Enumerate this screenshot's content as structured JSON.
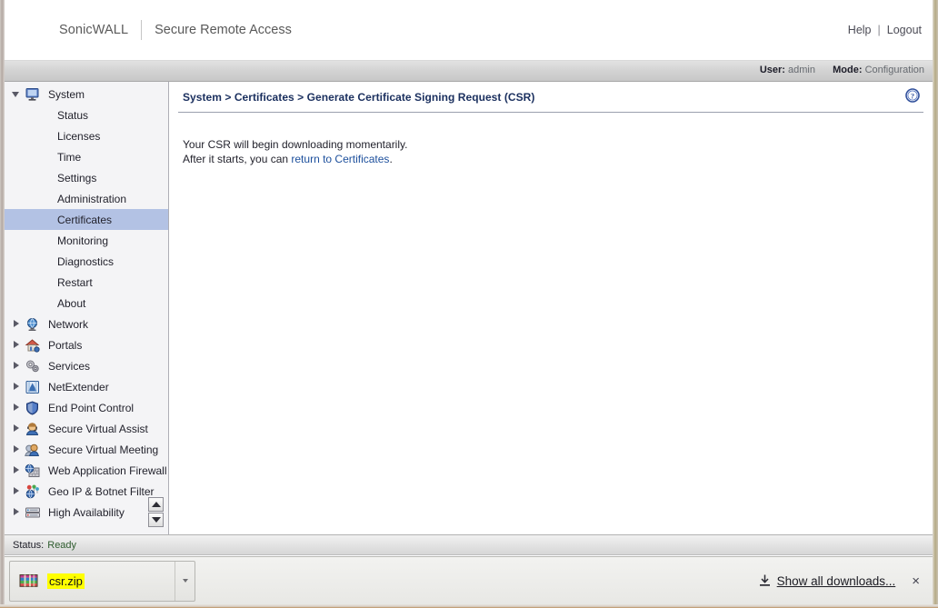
{
  "header": {
    "brand": "SonicWALL",
    "product": "Secure Remote Access",
    "help_link": "Help",
    "separator": "|",
    "logout_link": "Logout"
  },
  "status_strip": {
    "user_label": "User:",
    "user_value": "admin",
    "mode_label": "Mode:",
    "mode_value": "Configuration"
  },
  "sidebar": {
    "groups": [
      {
        "label": "System",
        "icon": "monitor-icon",
        "expanded": true,
        "twisty": "down",
        "children": [
          {
            "label": "Status",
            "selected": false
          },
          {
            "label": "Licenses",
            "selected": false
          },
          {
            "label": "Time",
            "selected": false
          },
          {
            "label": "Settings",
            "selected": false
          },
          {
            "label": "Administration",
            "selected": false
          },
          {
            "label": "Certificates",
            "selected": true
          },
          {
            "label": "Monitoring",
            "selected": false
          },
          {
            "label": "Diagnostics",
            "selected": false
          },
          {
            "label": "Restart",
            "selected": false
          },
          {
            "label": "About",
            "selected": false
          }
        ]
      },
      {
        "label": "Network",
        "icon": "globe-icon",
        "expanded": false,
        "twisty": "right",
        "children": []
      },
      {
        "label": "Portals",
        "icon": "house-icon",
        "expanded": false,
        "twisty": "right",
        "children": []
      },
      {
        "label": "Services",
        "icon": "gears-icon",
        "expanded": false,
        "twisty": "right",
        "children": []
      },
      {
        "label": "NetExtender",
        "icon": "netextender-icon",
        "expanded": false,
        "twisty": "right",
        "children": []
      },
      {
        "label": "End Point Control",
        "icon": "shield-icon",
        "expanded": false,
        "twisty": "right",
        "children": []
      },
      {
        "label": "Secure Virtual Assist",
        "icon": "headset-user-icon",
        "expanded": false,
        "twisty": "right",
        "children": []
      },
      {
        "label": "Secure Virtual Meeting",
        "icon": "two-users-icon",
        "expanded": false,
        "twisty": "right",
        "children": []
      },
      {
        "label": "Web Application Firewall",
        "icon": "globe-wall-icon",
        "expanded": false,
        "twisty": "right",
        "children": []
      },
      {
        "label": "Geo IP & Botnet Filter",
        "icon": "geo-balloons-icon",
        "expanded": false,
        "twisty": "right",
        "children": []
      },
      {
        "label": "High Availability",
        "icon": "server-icon",
        "expanded": false,
        "twisty": "right",
        "children": []
      }
    ],
    "scroll_up": "scroll-up-button",
    "scroll_down": "scroll-down-button"
  },
  "main": {
    "breadcrumb": "System > Certificates > Generate Certificate Signing Request (CSR)",
    "help_icon": "help-circle-icon",
    "message_line1": "Your CSR will begin downloading momentarily.",
    "message_line2_prefix": "After it starts, you can ",
    "message_link": "return to Certificates",
    "message_line2_suffix": "."
  },
  "app_status": {
    "label": "Status:",
    "value": "Ready"
  },
  "download_shelf": {
    "file_name": "csr.zip",
    "file_icon": "zip-archive-icon",
    "menu_icon": "chevron-down-icon",
    "show_all_label": "Show all downloads...",
    "show_all_icon": "download-arrow-icon",
    "close_label": "×"
  },
  "colors": {
    "selected_nav": "#b3c2e4",
    "breadcrumb": "#1a2f5e",
    "link": "#1c4f9c",
    "highlight": "#ffff00",
    "status_ok": "#2e5c2e"
  }
}
